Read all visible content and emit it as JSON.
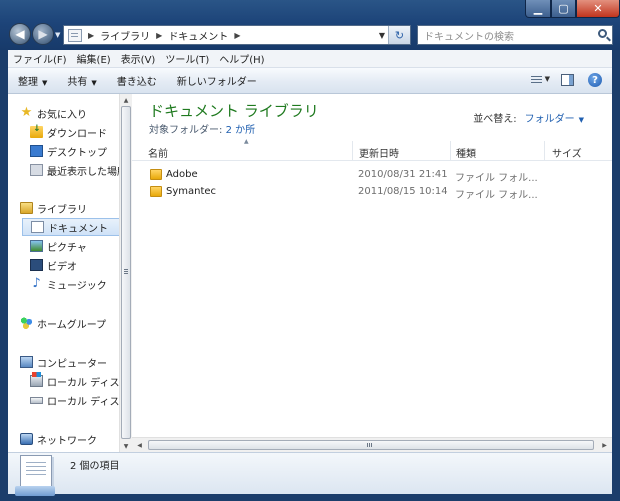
{
  "address": {
    "crumbs": [
      "ライブラリ",
      "ドキュメント"
    ]
  },
  "search": {
    "placeholder": "ドキュメントの検索"
  },
  "menu": [
    "ファイル(F)",
    "編集(E)",
    "表示(V)",
    "ツール(T)",
    "ヘルプ(H)"
  ],
  "toolbar": {
    "organize": "整理",
    "share": "共有",
    "burn": "書き込む",
    "new_folder": "新しいフォルダー"
  },
  "nav": {
    "favorites": "お気に入り",
    "downloads": "ダウンロード",
    "desktop": "デスクトップ",
    "recent": "最近表示した場所",
    "libraries": "ライブラリ",
    "documents": "ドキュメント",
    "pictures": "ピクチャ",
    "videos": "ビデオ",
    "music": "ミュージック",
    "homegroup": "ホームグループ",
    "computer": "コンピューター",
    "local_disk_1": "ローカル ディスク",
    "local_disk_2": "ローカル ディスク",
    "network": "ネットワーク"
  },
  "library": {
    "title": "ドキュメント ライブラリ",
    "subtitle_label": "対象フォルダー:",
    "subtitle_link": "2 か所",
    "arrange_label": "並べ替え:",
    "arrange_value": "フォルダー"
  },
  "columns": {
    "name": "名前",
    "modified": "更新日時",
    "type": "種類",
    "size": "サイズ"
  },
  "files": [
    {
      "name": "Adobe",
      "modified": "2010/08/31 21:41",
      "type": "ファイル フォル..."
    },
    {
      "name": "Symantec",
      "modified": "2011/08/15 10:14",
      "type": "ファイル フォル..."
    }
  ],
  "status": {
    "count_text": "2 個の項目"
  },
  "colors": {
    "title_green": "#1f7a1f",
    "link_blue": "#1f5fb0",
    "frame": "#1b3d6b"
  }
}
